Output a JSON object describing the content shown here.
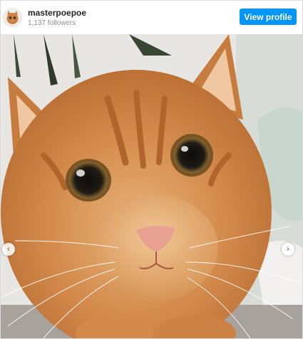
{
  "header": {
    "username": "masterpoepoe",
    "followers": "1,137 followers",
    "view_profile_label": "View profile"
  },
  "photo": {
    "subject": "orange-tabby-cat",
    "colors": {
      "fur": "#d38a4b",
      "fur_light": "#e9b47a",
      "fur_dark": "#b66a30",
      "eye": "#1e1a14",
      "eye_iris": "#8a6a32",
      "nose": "#e8a090",
      "background": "#e8e6e3"
    }
  },
  "carousel": {
    "prev_icon": "chevron-left-icon",
    "next_icon": "chevron-right-icon",
    "prev_glyph": "‹",
    "next_glyph": "›"
  },
  "colors": {
    "accent": "#0095f6"
  }
}
